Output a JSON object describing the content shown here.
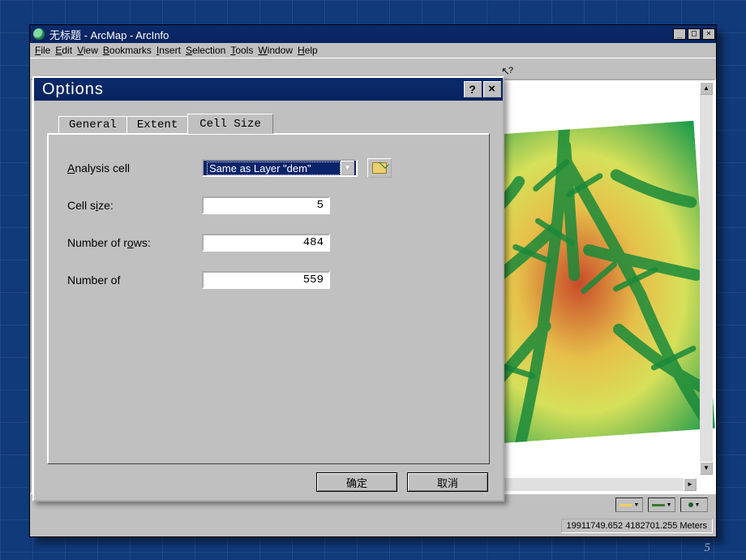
{
  "slide_number": "5",
  "arcmap": {
    "title": "无标题 - ArcMap - ArcInfo",
    "menu": [
      "File",
      "Edit",
      "View",
      "Bookmarks",
      "Insert",
      "Selection",
      "Tools",
      "Window",
      "Help"
    ],
    "status": "19911749.652  4182701.255 Meters"
  },
  "dialog": {
    "title": "Options",
    "tabs": {
      "general": "General",
      "extent": "Extent",
      "cell_size": "Cell Size"
    },
    "labels": {
      "analysis_cell": "Analysis cell",
      "cell_size": "Cell size:",
      "num_rows": "Number of rows:",
      "num_cols": "Number of"
    },
    "values": {
      "analysis_cell": "Same as Layer \"dem\"",
      "cell_size": "5",
      "num_rows": "484",
      "num_cols": "559"
    },
    "buttons": {
      "ok": "确定",
      "cancel": "取消"
    }
  }
}
